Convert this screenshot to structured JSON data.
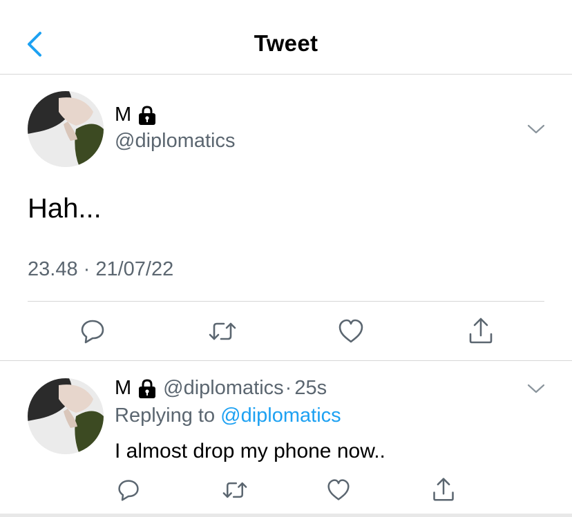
{
  "header": {
    "title": "Tweet"
  },
  "main_tweet": {
    "author_name": "M",
    "author_handle": "@diplomatics",
    "text": "Hah...",
    "timestamp": "23.48 · 21/07/22"
  },
  "reply": {
    "author_name": "M",
    "author_handle": "@diplomatics",
    "separator": "·",
    "time_ago": "25s",
    "replying_prefix": "Replying to",
    "replying_mention": "@diplomatics",
    "text": "I almost drop my phone now.."
  },
  "icons": {
    "back": "chevron-left-icon",
    "protected": "lock-icon",
    "more": "chevron-down-icon",
    "reply": "speech-bubble-icon",
    "retweet": "retweet-icon",
    "like": "heart-icon",
    "share": "share-icon"
  },
  "colors": {
    "accent": "#1da1f2",
    "secondary_text": "#5b6670",
    "icon_gray": "#5b6670",
    "divider": "#d6d6d6"
  }
}
